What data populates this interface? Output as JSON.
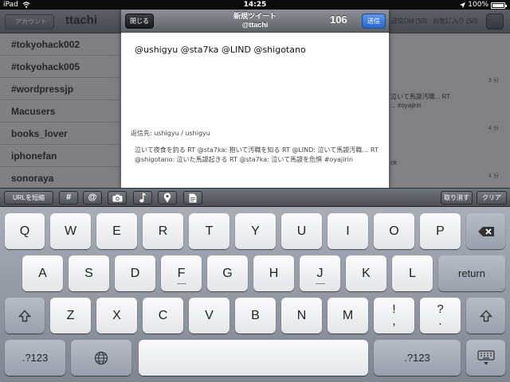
{
  "statusbar": {
    "device": "iPad",
    "time": "14:25",
    "battery": "100%"
  },
  "background_app": {
    "back_label": "アカウント",
    "title": "ttachi",
    "tabs": [
      "送信DM (50)",
      "お気に入り (50)"
    ],
    "list_items": [
      "#tokyohack002",
      "#tokyohack005",
      "#wordpressjp",
      "Macusers",
      "books_lover",
      "iphonefan",
      "sonoraya"
    ],
    "right_snippets": [
      "泣いて馬謖汚職... RT",
      "... #oyajirin",
      "ck"
    ],
    "right_times": [
      "3 分",
      "4 分",
      "4 分"
    ]
  },
  "compose": {
    "close_label": "閉じる",
    "title": "新規ツイート",
    "account": "@ttachi",
    "char_count": "106",
    "send_label": "送信",
    "text": "@ushigyu @sta7ka @LIND @shigotano",
    "reply_to": "返信先: ushigyu / ushigyu",
    "quote": "泣いて夜食を釣る RT @sta7ka: 抱いて汚職を知る RT @LIND: 泣いて馬謖汚職… RT @shigotano: 泣いた馬謖起きる RT @sta7ka: 泣いて馬謖を危惧 #oyajirin"
  },
  "accessory": {
    "shorten_url_label": "URLを短縮",
    "hash_label": "#",
    "at_label": "@",
    "cancel_label": "取り消す",
    "clear_label": "クリア",
    "icons": [
      "camera-icon",
      "music-note-icon",
      "location-pin-icon",
      "document-icon"
    ]
  },
  "keyboard": {
    "row1": [
      "Q",
      "W",
      "E",
      "R",
      "T",
      "Y",
      "U",
      "I",
      "O",
      "P"
    ],
    "row2": [
      "A",
      "S",
      "D",
      "F",
      "G",
      "H",
      "J",
      "K",
      "L"
    ],
    "row3": [
      "Z",
      "X",
      "C",
      "V",
      "B",
      "N",
      "M",
      "!",
      "?"
    ],
    "row3_sub": [
      ",",
      "."
    ],
    "return_label": "return",
    "numbers_label": ".?123"
  }
}
